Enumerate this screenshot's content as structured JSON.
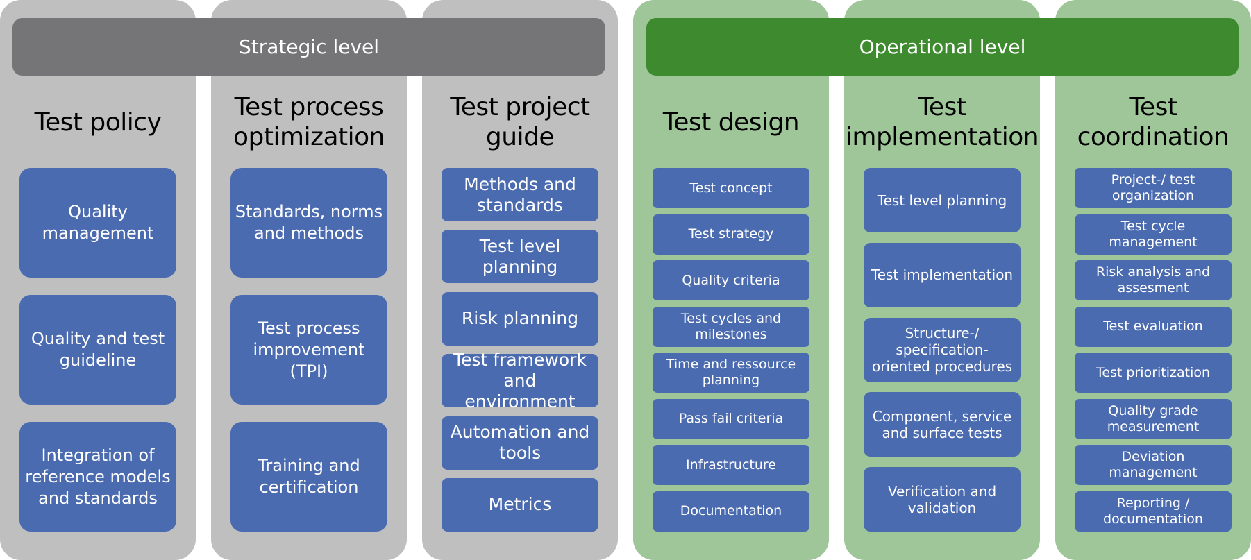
{
  "levels": {
    "strategic": {
      "label": "Strategic level",
      "color": "#757577",
      "column_color": "#bfbfbf"
    },
    "operational": {
      "label": "Operational level",
      "color": "#3e8a2f",
      "column_color": "#9ec698"
    }
  },
  "box_color": "#4b6bb0",
  "columns": [
    {
      "level": "strategic",
      "title": "Test policy",
      "items": [
        "Quality management",
        "Quality and test guideline",
        "Integration of reference models and standards"
      ]
    },
    {
      "level": "strategic",
      "title": "Test process optimization",
      "items": [
        "Standards, norms and methods",
        "Test process improvement (TPI)",
        "Training and certification"
      ]
    },
    {
      "level": "strategic",
      "title": "Test project guide",
      "items": [
        "Methods and standards",
        "Test level planning",
        "Risk planning",
        "Test framework and environment",
        "Automation and tools",
        "Metrics"
      ]
    },
    {
      "level": "operational",
      "title": "Test design",
      "items": [
        "Test concept",
        "Test strategy",
        "Quality criteria",
        "Test cycles and milestones",
        "Time and ressource planning",
        "Pass fail criteria",
        "Infrastructure",
        "Documentation"
      ]
    },
    {
      "level": "operational",
      "title": "Test implementation",
      "items": [
        "Test level planning",
        "Test implementation",
        "Structure-/ specification-oriented procedures",
        "Component, service and surface tests",
        "Verification and validation"
      ]
    },
    {
      "level": "operational",
      "title": "Test coordination",
      "items": [
        "Project-/ test organization",
        "Test cycle management",
        "Risk analysis and assesment",
        "Test evaluation",
        "Test prioritization",
        "Quality grade measurement",
        "Deviation management",
        "Reporting / documentation"
      ]
    }
  ]
}
